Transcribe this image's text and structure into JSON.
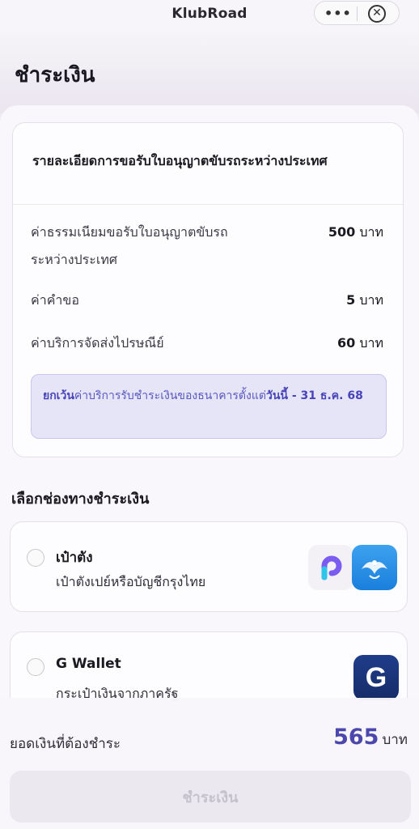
{
  "app": {
    "title": "KlubRoad",
    "more_glyph": "•••",
    "close_glyph": "✕"
  },
  "page": {
    "title": "ชำระเงิน"
  },
  "details": {
    "title": "รายละเอียดการขอรับใบอนุญาตขับรถระหว่างประเทศ",
    "fees": [
      {
        "label": "ค่าธรรมเนียมขอรับใบอนุญาตขับรถระหว่างประเทศ",
        "amount": "500",
        "unit": "บาท"
      },
      {
        "label": "ค่าคำขอ",
        "amount": "5",
        "unit": "บาท"
      },
      {
        "label": "ค่าบริการจัดส่งไปรษณีย์",
        "amount": "60",
        "unit": "บาท"
      }
    ],
    "note": {
      "prefix": "ยกเว้น",
      "text": "ค่าบริการรับชำระเงินของธนาคารตั้งแต่",
      "highlight": "วันนี้ - 31 ธ.ค. 68"
    }
  },
  "payment": {
    "section_label": "เลือกช่องทางชำระเงิน",
    "options": [
      {
        "name": "เป๋าตัง",
        "description": "เป๋าตังเปย์หรือบัญชีกรุงไทย",
        "selected": false,
        "icons": [
          "paotang-logo-icon",
          "krungthai-logo-icon"
        ]
      },
      {
        "name": "G Wallet",
        "description": "กระเป๋าเงินจากภาครัฐ",
        "selected": false,
        "icons": [
          "g-wallet-logo-icon"
        ],
        "icon_glyph": "G"
      }
    ]
  },
  "total": {
    "label": "ยอดเงินที่ต้องชำระ",
    "amount": "565",
    "unit": "บาท"
  },
  "pay_button": {
    "label": "ชำระเงิน",
    "enabled": false
  },
  "colors": {
    "accent": "#4b47ad",
    "note_bg": "#e6e5f8",
    "note_text": "#5b58c0",
    "ktb_blue": "#1a7fdc",
    "gwallet_navy": "#1f3d8a"
  }
}
